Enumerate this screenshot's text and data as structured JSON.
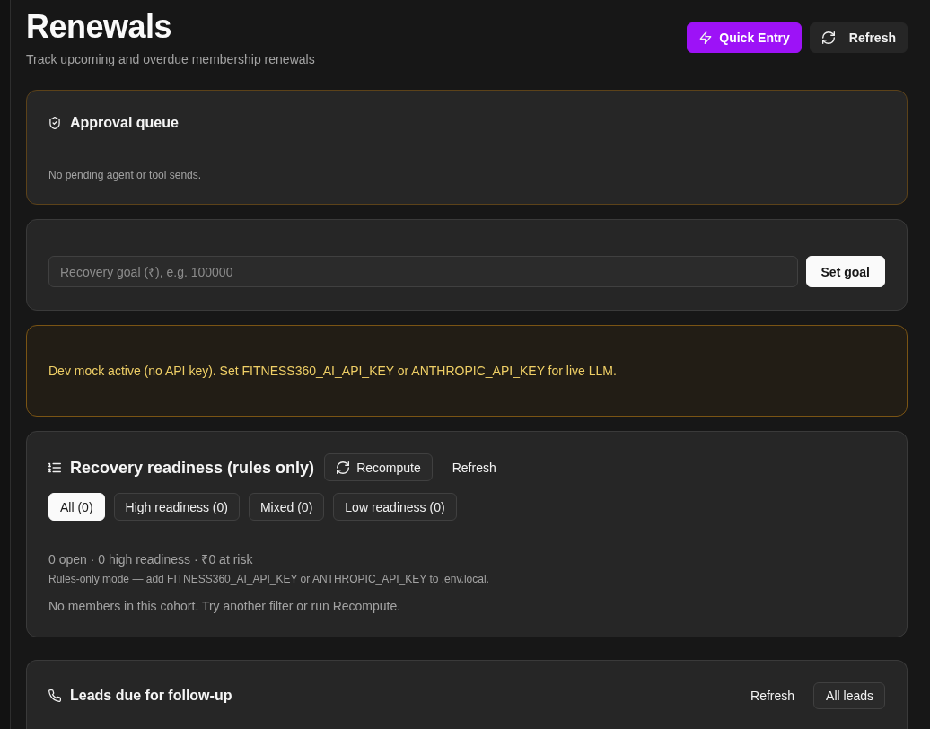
{
  "header": {
    "title": "Renewals",
    "subtitle": "Track upcoming and overdue membership renewals",
    "buttons": [
      {
        "kind": "primary",
        "label": "Quick Entry"
      },
      {
        "kind": "secondary",
        "label": "Refresh"
      }
    ]
  },
  "approval_queue": {
    "title": "Approval queue",
    "empty_text": "No pending agent or tool sends."
  },
  "goal": {
    "placeholder": "Recovery goal (₹), e.g. 100000",
    "button": {
      "kind": "light",
      "label": "Set goal"
    }
  },
  "notice": {
    "text": "Dev mock active (no API key). Set FITNESS360_AI_API_KEY or ANTHROPIC_API_KEY for live LLM."
  },
  "readiness": {
    "title": "Recovery readiness (rules only)",
    "buttons": [
      {
        "kind": "outline",
        "label": "Recompute"
      },
      {
        "kind": "ghost",
        "label": "Refresh"
      }
    ],
    "filters": [
      {
        "label": "All (0)",
        "selected": true
      },
      {
        "label": "High readiness (0)",
        "selected": false
      },
      {
        "label": "Mixed (0)",
        "selected": false
      },
      {
        "label": "Low readiness (0)",
        "selected": false
      }
    ],
    "summary": "0 open · 0 high readiness · ₹0 at risk",
    "mode_note": "Rules-only mode — add FITNESS360_AI_API_KEY or ANTHROPIC_API_KEY to .env.local.",
    "empty_text": "No members in this cohort. Try another filter or run Recompute."
  },
  "leads": {
    "title": "Leads due for follow-up",
    "buttons": [
      {
        "kind": "ghost",
        "label": "Refresh"
      },
      {
        "kind": "outline",
        "label": "All leads"
      }
    ]
  }
}
